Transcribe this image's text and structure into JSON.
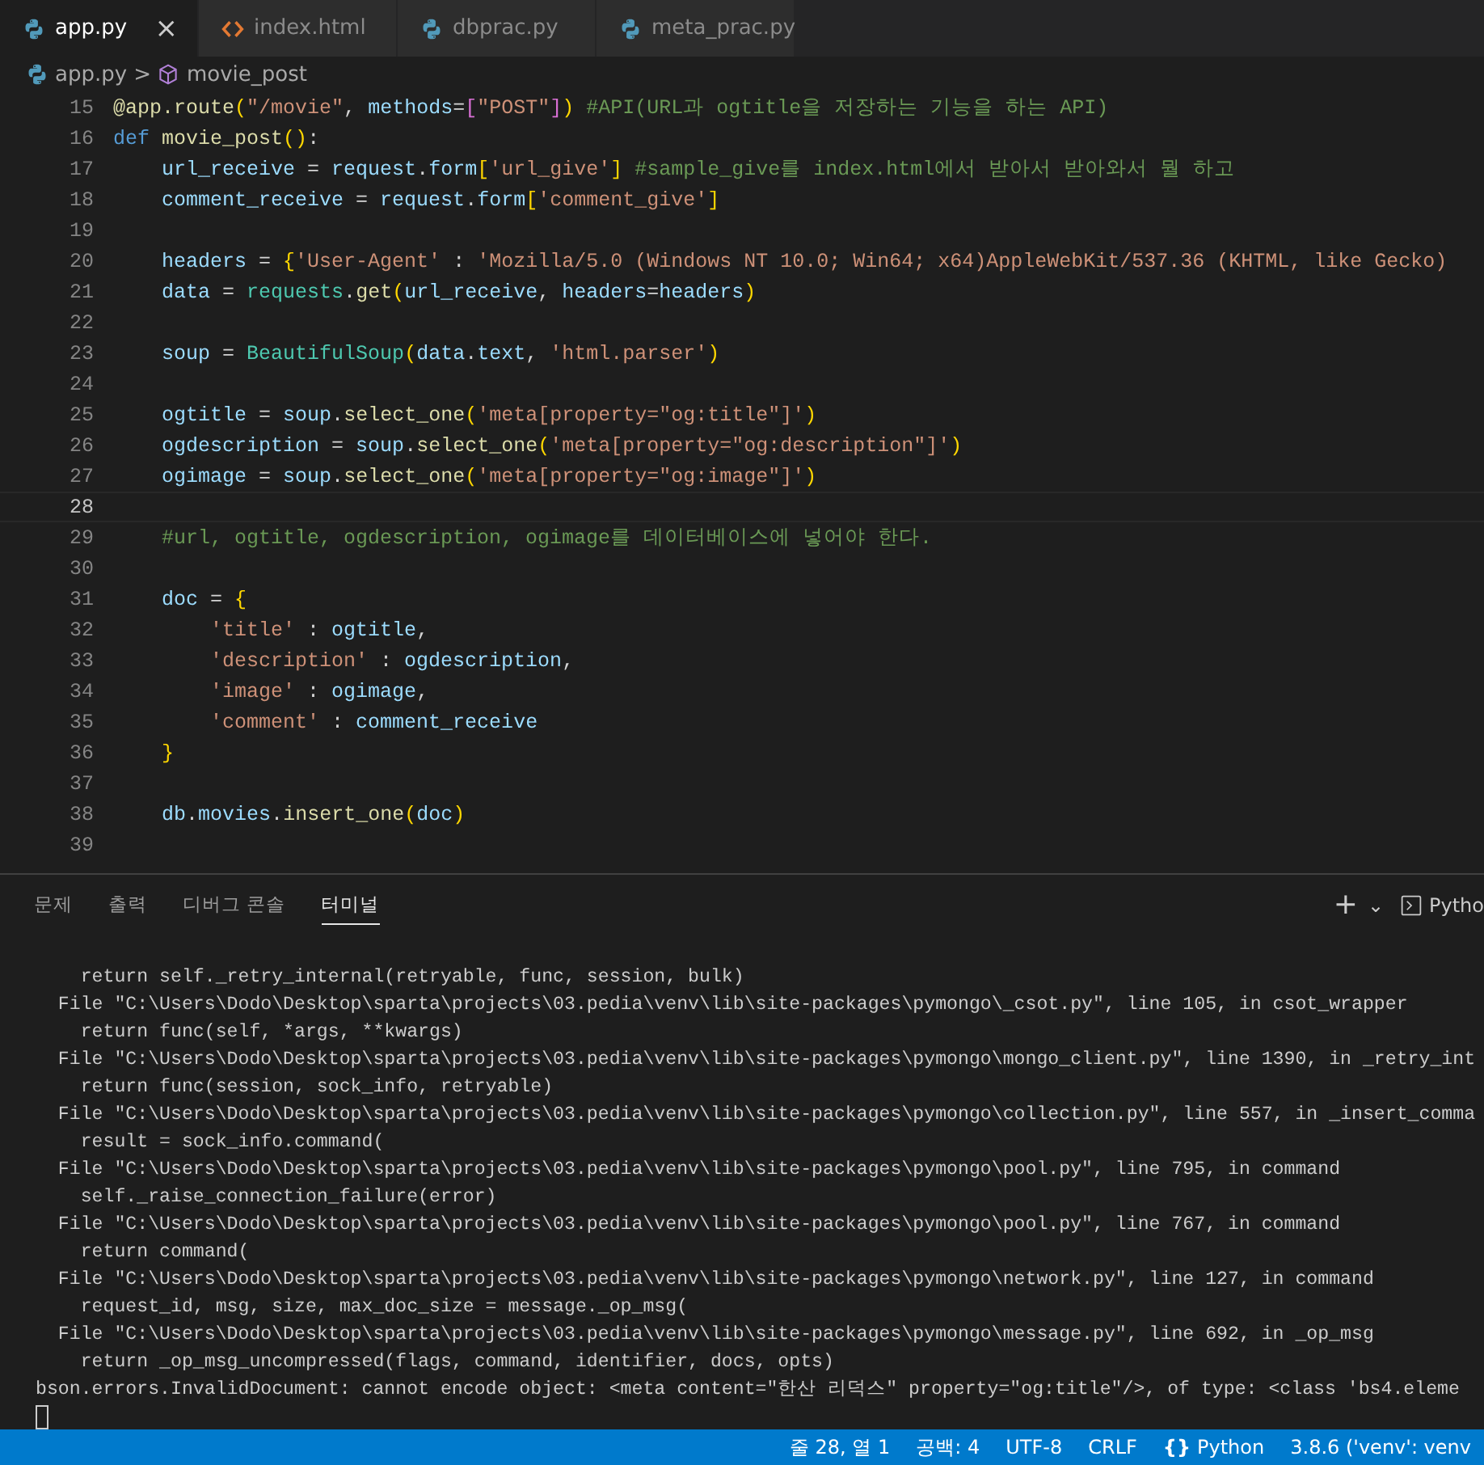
{
  "tabs": [
    {
      "label": "app.py",
      "kind": "python",
      "selected": true
    },
    {
      "label": "index.html",
      "kind": "html",
      "selected": false
    },
    {
      "label": "dbprac.py",
      "kind": "python",
      "selected": false
    },
    {
      "label": "meta_prac.py",
      "kind": "python",
      "selected": false
    }
  ],
  "close_glyph": "×",
  "breadcrumb": {
    "file": "app.py",
    "separator": ">",
    "symbol": "movie_post"
  },
  "editor_lines": [
    {
      "number": "15",
      "current": false,
      "tokens": [
        {
          "text": "@app.route",
          "kind": "fn"
        },
        {
          "text": "(",
          "kind": "br1"
        },
        {
          "text": "\"/movie\"",
          "kind": "str"
        },
        {
          "text": ", ",
          "kind": "plain"
        },
        {
          "text": "methods",
          "kind": "var"
        },
        {
          "text": "=",
          "kind": "plain"
        },
        {
          "text": "[",
          "kind": "br2"
        },
        {
          "text": "\"POST\"",
          "kind": "str"
        },
        {
          "text": "]",
          "kind": "br2"
        },
        {
          "text": ")",
          "kind": "br1"
        },
        {
          "text": " #API(URL과 ogtitle을 저장하는 기능을 하는 API)",
          "kind": "com"
        }
      ]
    },
    {
      "number": "16",
      "current": false,
      "tokens": [
        {
          "text": "def",
          "kind": "kw"
        },
        {
          "text": " movie_post",
          "kind": "fn"
        },
        {
          "text": "(",
          "kind": "br1"
        },
        {
          "text": ")",
          "kind": "br1"
        },
        {
          "text": ":",
          "kind": "plain"
        }
      ]
    },
    {
      "number": "17",
      "current": false,
      "tokens": [
        {
          "text": "    url_receive",
          "kind": "var"
        },
        {
          "text": " = ",
          "kind": "plain"
        },
        {
          "text": "request",
          "kind": "var"
        },
        {
          "text": ".",
          "kind": "plain"
        },
        {
          "text": "form",
          "kind": "var"
        },
        {
          "text": "[",
          "kind": "br1"
        },
        {
          "text": "'url_give'",
          "kind": "str"
        },
        {
          "text": "]",
          "kind": "br1"
        },
        {
          "text": " #sample_give를 index.html에서 받아서 받아와서 뭘 하고",
          "kind": "com"
        }
      ]
    },
    {
      "number": "18",
      "current": false,
      "tokens": [
        {
          "text": "    comment_receive",
          "kind": "var"
        },
        {
          "text": " = ",
          "kind": "plain"
        },
        {
          "text": "request",
          "kind": "var"
        },
        {
          "text": ".",
          "kind": "plain"
        },
        {
          "text": "form",
          "kind": "var"
        },
        {
          "text": "[",
          "kind": "br1"
        },
        {
          "text": "'comment_give'",
          "kind": "str"
        },
        {
          "text": "]",
          "kind": "br1"
        }
      ]
    },
    {
      "number": "19",
      "current": false
    },
    {
      "number": "20",
      "current": false,
      "tokens": [
        {
          "text": "    headers",
          "kind": "var"
        },
        {
          "text": " = ",
          "kind": "plain"
        },
        {
          "text": "{",
          "kind": "br1"
        },
        {
          "text": "'User-Agent'",
          "kind": "str"
        },
        {
          "text": " : ",
          "kind": "plain"
        },
        {
          "text": "'Mozilla/5.0 (Windows NT 10.0; Win64; x64)AppleWebKit/537.36 (KHTML, like Gecko)",
          "kind": "str"
        }
      ]
    },
    {
      "number": "21",
      "current": false,
      "tokens": [
        {
          "text": "    data",
          "kind": "var"
        },
        {
          "text": " = ",
          "kind": "plain"
        },
        {
          "text": "requests",
          "kind": "cls"
        },
        {
          "text": ".",
          "kind": "plain"
        },
        {
          "text": "get",
          "kind": "fn"
        },
        {
          "text": "(",
          "kind": "br1"
        },
        {
          "text": "url_receive",
          "kind": "var"
        },
        {
          "text": ", ",
          "kind": "plain"
        },
        {
          "text": "headers",
          "kind": "var"
        },
        {
          "text": "=",
          "kind": "plain"
        },
        {
          "text": "headers",
          "kind": "var"
        },
        {
          "text": ")",
          "kind": "br1"
        }
      ]
    },
    {
      "number": "22",
      "current": false
    },
    {
      "number": "23",
      "current": false,
      "tokens": [
        {
          "text": "    soup",
          "kind": "var"
        },
        {
          "text": " = ",
          "kind": "plain"
        },
        {
          "text": "BeautifulSoup",
          "kind": "cls"
        },
        {
          "text": "(",
          "kind": "br1"
        },
        {
          "text": "data",
          "kind": "var"
        },
        {
          "text": ".",
          "kind": "plain"
        },
        {
          "text": "text",
          "kind": "var"
        },
        {
          "text": ", ",
          "kind": "plain"
        },
        {
          "text": "'html.parser'",
          "kind": "str"
        },
        {
          "text": ")",
          "kind": "br1"
        }
      ]
    },
    {
      "number": "24",
      "current": false
    },
    {
      "number": "25",
      "current": false,
      "tokens": [
        {
          "text": "    ogtitle",
          "kind": "var"
        },
        {
          "text": " = ",
          "kind": "plain"
        },
        {
          "text": "soup",
          "kind": "var"
        },
        {
          "text": ".",
          "kind": "plain"
        },
        {
          "text": "select_one",
          "kind": "fn"
        },
        {
          "text": "(",
          "kind": "br1"
        },
        {
          "text": "'meta[property=\"og:title\"]'",
          "kind": "str"
        },
        {
          "text": ")",
          "kind": "br1"
        }
      ]
    },
    {
      "number": "26",
      "current": false,
      "tokens": [
        {
          "text": "    ogdescription",
          "kind": "var"
        },
        {
          "text": " = ",
          "kind": "plain"
        },
        {
          "text": "soup",
          "kind": "var"
        },
        {
          "text": ".",
          "kind": "plain"
        },
        {
          "text": "select_one",
          "kind": "fn"
        },
        {
          "text": "(",
          "kind": "br1"
        },
        {
          "text": "'meta[property=\"og:description\"]'",
          "kind": "str"
        },
        {
          "text": ")",
          "kind": "br1"
        }
      ]
    },
    {
      "number": "27",
      "current": false,
      "tokens": [
        {
          "text": "    ogimage",
          "kind": "var"
        },
        {
          "text": " = ",
          "kind": "plain"
        },
        {
          "text": "soup",
          "kind": "var"
        },
        {
          "text": ".",
          "kind": "plain"
        },
        {
          "text": "select_one",
          "kind": "fn"
        },
        {
          "text": "(",
          "kind": "br1"
        },
        {
          "text": "'meta[property=\"og:image\"]'",
          "kind": "str"
        },
        {
          "text": ")",
          "kind": "br1"
        }
      ]
    },
    {
      "number": "28",
      "current": true
    },
    {
      "number": "29",
      "current": false,
      "tokens": [
        {
          "text": "    #url, ogtitle, ogdescription, ogimage를 데이터베이스에 넣어야 한다.",
          "kind": "com"
        }
      ]
    },
    {
      "number": "30",
      "current": false
    },
    {
      "number": "31",
      "current": false,
      "tokens": [
        {
          "text": "    doc",
          "kind": "var"
        },
        {
          "text": " = ",
          "kind": "plain"
        },
        {
          "text": "{",
          "kind": "br1"
        }
      ]
    },
    {
      "number": "32",
      "current": false,
      "tokens": [
        {
          "text": "        'title'",
          "kind": "str"
        },
        {
          "text": " : ",
          "kind": "plain"
        },
        {
          "text": "ogtitle",
          "kind": "var"
        },
        {
          "text": ",",
          "kind": "plain"
        }
      ]
    },
    {
      "number": "33",
      "current": false,
      "tokens": [
        {
          "text": "        'description'",
          "kind": "str"
        },
        {
          "text": " : ",
          "kind": "plain"
        },
        {
          "text": "ogdescription",
          "kind": "var"
        },
        {
          "text": ",",
          "kind": "plain"
        }
      ]
    },
    {
      "number": "34",
      "current": false,
      "tokens": [
        {
          "text": "        'image'",
          "kind": "str"
        },
        {
          "text": " : ",
          "kind": "plain"
        },
        {
          "text": "ogimage",
          "kind": "var"
        },
        {
          "text": ",",
          "kind": "plain"
        }
      ]
    },
    {
      "number": "35",
      "current": false,
      "tokens": [
        {
          "text": "        'comment'",
          "kind": "str"
        },
        {
          "text": " : ",
          "kind": "plain"
        },
        {
          "text": "comment_receive",
          "kind": "var"
        }
      ]
    },
    {
      "number": "36",
      "current": false,
      "tokens": [
        {
          "text": "    }",
          "kind": "br1"
        }
      ]
    },
    {
      "number": "37",
      "current": false
    },
    {
      "number": "38",
      "current": false,
      "tokens": [
        {
          "text": "    db",
          "kind": "var"
        },
        {
          "text": ".",
          "kind": "plain"
        },
        {
          "text": "movies",
          "kind": "var"
        },
        {
          "text": ".",
          "kind": "plain"
        },
        {
          "text": "insert_one",
          "kind": "fn"
        },
        {
          "text": "(",
          "kind": "br1"
        },
        {
          "text": "doc",
          "kind": "var"
        },
        {
          "text": ")",
          "kind": "br1"
        }
      ]
    },
    {
      "number": "39",
      "current": false
    }
  ],
  "panel_tabs": [
    {
      "label": "문제",
      "selected": false
    },
    {
      "label": "출력",
      "selected": false
    },
    {
      "label": "디버그 콘솔",
      "selected": false
    },
    {
      "label": "터미널",
      "selected": true
    }
  ],
  "panel_actions": {
    "add": "+",
    "dropdown": "⌄",
    "terminal_name": "Pytho"
  },
  "terminal_lines": [
    "    return self._retry_internal(retryable, func, session, bulk)",
    "  File \"C:\\Users\\Dodo\\Desktop\\sparta\\projects\\03.pedia\\venv\\lib\\site-packages\\pymongo\\_csot.py\", line 105, in csot_wrapper",
    "    return func(self, *args, **kwargs)",
    "  File \"C:\\Users\\Dodo\\Desktop\\sparta\\projects\\03.pedia\\venv\\lib\\site-packages\\pymongo\\mongo_client.py\", line 1390, in _retry_int",
    "    return func(session, sock_info, retryable)",
    "  File \"C:\\Users\\Dodo\\Desktop\\sparta\\projects\\03.pedia\\venv\\lib\\site-packages\\pymongo\\collection.py\", line 557, in _insert_comma",
    "    result = sock_info.command(",
    "  File \"C:\\Users\\Dodo\\Desktop\\sparta\\projects\\03.pedia\\venv\\lib\\site-packages\\pymongo\\pool.py\", line 795, in command",
    "    self._raise_connection_failure(error)",
    "  File \"C:\\Users\\Dodo\\Desktop\\sparta\\projects\\03.pedia\\venv\\lib\\site-packages\\pymongo\\pool.py\", line 767, in command",
    "    return command(",
    "  File \"C:\\Users\\Dodo\\Desktop\\sparta\\projects\\03.pedia\\venv\\lib\\site-packages\\pymongo\\network.py\", line 127, in command",
    "    request_id, msg, size, max_doc_size = message._op_msg(",
    "  File \"C:\\Users\\Dodo\\Desktop\\sparta\\projects\\03.pedia\\venv\\lib\\site-packages\\pymongo\\message.py\", line 692, in _op_msg",
    "    return _op_msg_uncompressed(flags, command, identifier, docs, opts)",
    "bson.errors.InvalidDocument: cannot encode object: <meta content=\"한산 리덕스\" property=\"og:title\"/>, of type: <class 'bs4.eleme"
  ],
  "status_bar": {
    "position": "줄 28, 열 1",
    "spaces": "공백: 4",
    "encoding": "UTF-8",
    "line_ending": "CRLF",
    "language_glyph": "{}",
    "language": "Python",
    "interpreter": "3.8.6 ('venv': venv"
  }
}
